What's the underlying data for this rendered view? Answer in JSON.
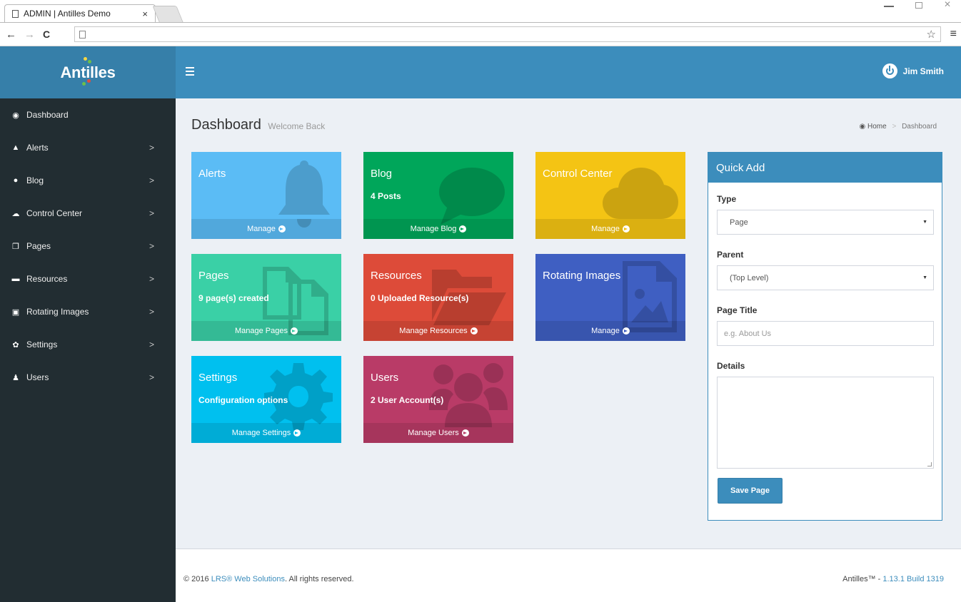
{
  "browser": {
    "tab_title": "ADMIN | Antilles Demo",
    "tab_close": "×",
    "nav": {
      "back": "←",
      "forward": "→",
      "reload": "C"
    },
    "star": "☆",
    "menu": "≡"
  },
  "brand": {
    "logo_text": "Antilles",
    "dot_colors": [
      "#f6d743",
      "#6cc04a",
      "#e74c3c",
      "#3dbbe8"
    ]
  },
  "header": {
    "user_name": "Jim Smith"
  },
  "sidebar": {
    "items": [
      {
        "label": "Dashboard",
        "icon": "dashboard-icon",
        "glyph": "◉",
        "chevron": ""
      },
      {
        "label": "Alerts",
        "icon": "bell-icon",
        "glyph": "▲",
        "chevron": ">"
      },
      {
        "label": "Blog",
        "icon": "comment-icon",
        "glyph": "●",
        "chevron": ">"
      },
      {
        "label": "Control Center",
        "icon": "cloud-icon",
        "glyph": "☁",
        "chevron": ">"
      },
      {
        "label": "Pages",
        "icon": "files-icon",
        "glyph": "❐",
        "chevron": ">"
      },
      {
        "label": "Resources",
        "icon": "folder-open-icon",
        "glyph": "▬",
        "chevron": ">"
      },
      {
        "label": "Rotating Images",
        "icon": "picture-icon",
        "glyph": "▣",
        "chevron": ">"
      },
      {
        "label": "Settings",
        "icon": "cogs-icon",
        "glyph": "✿",
        "chevron": ">"
      },
      {
        "label": "Users",
        "icon": "users-icon",
        "glyph": "♟",
        "chevron": ">"
      }
    ]
  },
  "main": {
    "title": "Dashboard",
    "subtitle": "Welcome Back",
    "breadcrumb": {
      "home": "Home",
      "separator": ">",
      "current": "Dashboard"
    },
    "tiles": [
      {
        "title": "Alerts",
        "count": "",
        "footer": "Manage",
        "color": "#5bbcf5",
        "icon": "bell-icon"
      },
      {
        "title": "Blog",
        "count": "4 Posts",
        "footer": "Manage Blog",
        "color": "#00a65a",
        "icon": "comment-icon"
      },
      {
        "title": "Control Center",
        "count": "",
        "footer": "Manage",
        "color": "#f4c414",
        "icon": "cloud-icon"
      },
      {
        "title": "Pages",
        "count": "9 page(s) created",
        "footer": "Manage Pages",
        "color": "#3ad0a6",
        "icon": "files-icon"
      },
      {
        "title": "Resources",
        "count": "0 Uploaded Resource(s)",
        "footer": "Manage Resources",
        "color": "#dd4b39",
        "icon": "folder-open-icon"
      },
      {
        "title": "Rotating Images",
        "count": "",
        "footer": "Manage",
        "color": "#3f5fc2",
        "icon": "picture-icon"
      },
      {
        "title": "Settings",
        "count": "Configuration options",
        "footer": "Manage Settings",
        "color": "#00c0ef",
        "icon": "gear-icon"
      },
      {
        "title": "Users",
        "count": "2 User Account(s)",
        "footer": "Manage Users",
        "color": "#b93b67",
        "icon": "users-icon"
      }
    ]
  },
  "quick_add": {
    "title": "Quick Add",
    "type_label": "Type",
    "type_value": "Page",
    "parent_label": "Parent",
    "parent_value": "(Top Level)",
    "page_title_label": "Page Title",
    "page_title_placeholder": "e.g. About Us",
    "details_label": "Details",
    "details_value": "",
    "save_label": "Save Page"
  },
  "footer": {
    "copyright_prefix": "© 2016 ",
    "company": "LRS® Web Solutions",
    "copyright_suffix": ". All rights reserved.",
    "product": "Antilles™ - ",
    "version": "1.13.1 Build 1319"
  },
  "colors": {
    "primary": "#3c8dbc",
    "primary_dark": "#367fa9",
    "sidebar_bg": "#222d32",
    "content_bg": "#ecf0f5"
  }
}
